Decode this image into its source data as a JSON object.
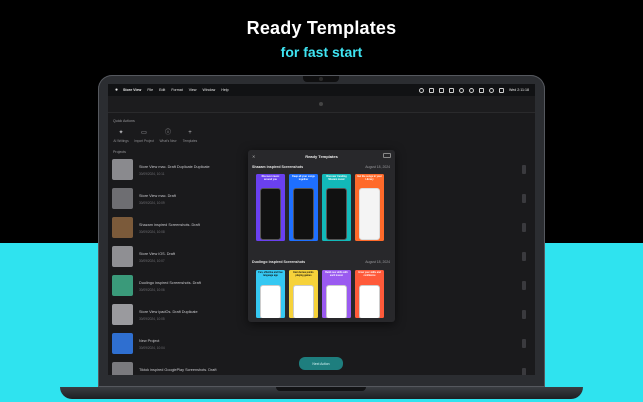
{
  "headline": "Ready Templates",
  "subline": "for fast start",
  "menubar": {
    "app_name": "Store View",
    "items": [
      "File",
      "Edit",
      "Format",
      "View",
      "Window",
      "Help"
    ],
    "clock": "Wed 2:11:18"
  },
  "sidebar": {
    "quick_actions_label": "Quick Actions",
    "quick_actions": [
      {
        "label": "AI Writings",
        "icon": "sparkle-icon"
      },
      {
        "label": "Import Project",
        "icon": "import-icon"
      },
      {
        "label": "What's New",
        "icon": "info-icon"
      },
      {
        "label": "Templates",
        "icon": "plus-icon"
      }
    ],
    "projects_label": "Projects",
    "projects": [
      {
        "title": "Store View mac. Draft Duplicate Duplicate",
        "date": "30/09/2024, 10:11",
        "thumb": "#8a8a8e"
      },
      {
        "title": "Store View mac. Draft",
        "date": "30/09/2024, 10:09",
        "thumb": "#6e6e72"
      },
      {
        "title": "Shazam inspired Screenshots. Draft",
        "date": "30/09/2024, 10:08",
        "thumb": "#7b5a3a"
      },
      {
        "title": "Store View iOS. Draft",
        "date": "30/09/2024, 10:07",
        "thumb": "#8f8f93"
      },
      {
        "title": "Duolingo inspired Screenshots. Draft",
        "date": "30/09/2024, 10:06",
        "thumb": "#3a9a7a"
      },
      {
        "title": "Store View ipadOs. Draft Duplicate",
        "date": "30/09/2024, 10:05",
        "thumb": "#9a9a9e"
      },
      {
        "title": "New Project",
        "date": "30/09/2024, 10:04",
        "thumb": "#2f6fd0"
      },
      {
        "title": "Tiktok inspired GooglePlay Screenshots. Draft",
        "date": "30/09/2024, 10:03",
        "thumb": "#7a7a7e"
      }
    ]
  },
  "modal": {
    "title": "Ready Templates",
    "groups": [
      {
        "name": "Shazam inspired Screenshots",
        "date": "August 18, 2024",
        "cards": [
          {
            "text": "Discover music around you",
            "bg": "#6a40f0"
          },
          {
            "text": "Keep all your songs together",
            "bg": "#1e6fff"
          },
          {
            "text": "Discover trending Shazam music",
            "bg": "#12b9b9"
          },
          {
            "text": "Get the songs in your Library",
            "bg": "#ff6a2a"
          }
        ]
      },
      {
        "name": "Duolingo inspired Screenshots",
        "date": "August 18, 2024",
        "cards": [
          {
            "text": "Fun, effective and free language app",
            "bg": "#35c8f2"
          },
          {
            "text": "Earn bonus points playing games",
            "bg": "#f6d23a"
          },
          {
            "text": "Build new skills with each lesson",
            "bg": "#9a5af0"
          },
          {
            "text": "Grow your skills and confidence",
            "bg": "#ff5a3a"
          }
        ]
      }
    ]
  },
  "bottom_button": "Next Action"
}
